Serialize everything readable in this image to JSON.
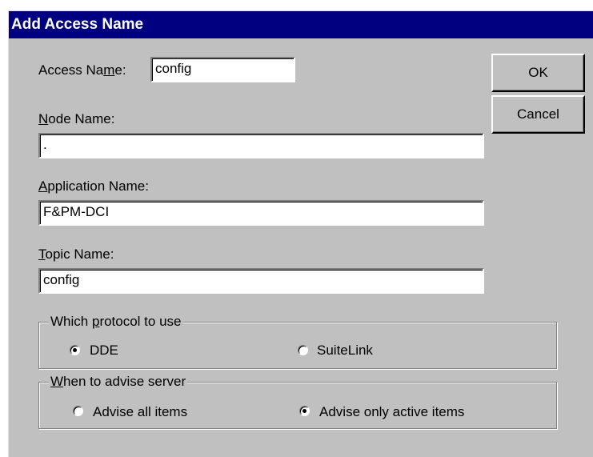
{
  "window": {
    "title": "Add Access Name"
  },
  "access_name": {
    "label_pre": "Access Na",
    "label_key": "m",
    "label_post": "e:",
    "value": "config"
  },
  "node_name": {
    "label_key": "N",
    "label_post": "ode Name:",
    "value": "."
  },
  "application_name": {
    "label_key": "A",
    "label_post": "pplication Name:",
    "value": "F&PM-DCI"
  },
  "topic_name": {
    "label_key": "T",
    "label_post": "opic Name:",
    "value": "config"
  },
  "buttons": {
    "ok": "OK",
    "cancel": "Cancel"
  },
  "protocol_group": {
    "legend_pre": "Which ",
    "legend_key": "p",
    "legend_post": "rotocol to use",
    "options": [
      "DDE",
      "SuiteLink"
    ],
    "selected": "DDE"
  },
  "advise_group": {
    "legend_key": "W",
    "legend_post": "hen to advise server",
    "options": [
      "Advise all items",
      "Advise only active items"
    ],
    "selected": "Advise only active items"
  }
}
